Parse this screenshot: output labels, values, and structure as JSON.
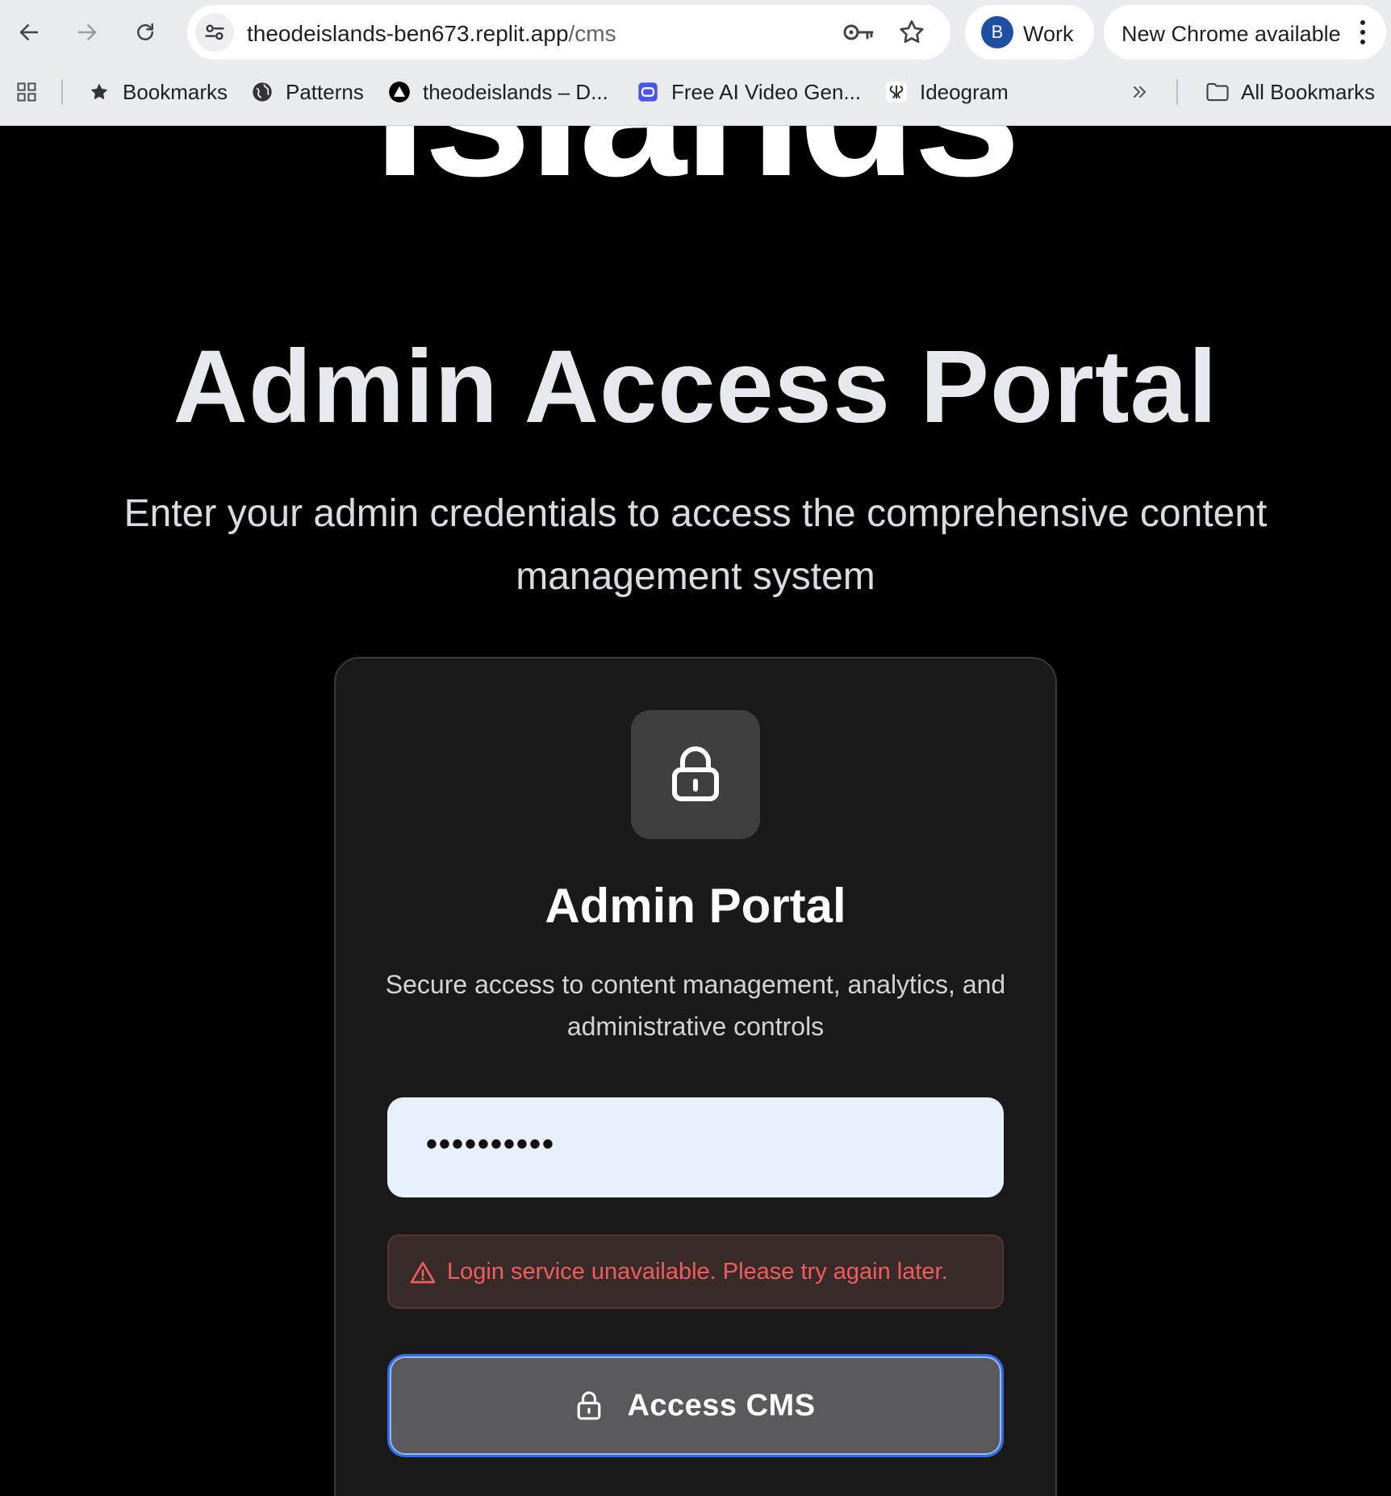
{
  "browser": {
    "url_host": "theodeislands-ben673.replit.app",
    "url_path": "/cms",
    "profile_initial": "B",
    "profile_name": "Work",
    "update_label": "New Chrome available",
    "bookmarks": [
      {
        "label": "Bookmarks",
        "icon": "star-icon"
      },
      {
        "label": "Patterns",
        "icon": "globe-icon"
      },
      {
        "label": "theodeislands – D...",
        "icon": "vercel-triangle-icon"
      },
      {
        "label": "Free AI Video Gen...",
        "icon": "video-app-icon"
      },
      {
        "label": "Ideogram",
        "icon": "ideogram-icon"
      }
    ],
    "all_bookmarks": "All Bookmarks"
  },
  "page": {
    "hero_word": "Islands",
    "title": "Admin Access Portal",
    "subtitle": "Enter your admin credentials to access the comprehensive content management system"
  },
  "card": {
    "title": "Admin Portal",
    "description": "Secure access to content management, analytics, and administrative controls",
    "password_value": "••••••••••",
    "error_message": "Login service unavailable. Please try again later.",
    "submit_label": "Access CMS"
  },
  "colors": {
    "background": "#000000",
    "card": "#1a1a1a",
    "input": "#e8f0fe",
    "error_text": "#ef5d5d",
    "button": "#5a5a5c",
    "button_focus_ring": "#2f6ce8"
  }
}
